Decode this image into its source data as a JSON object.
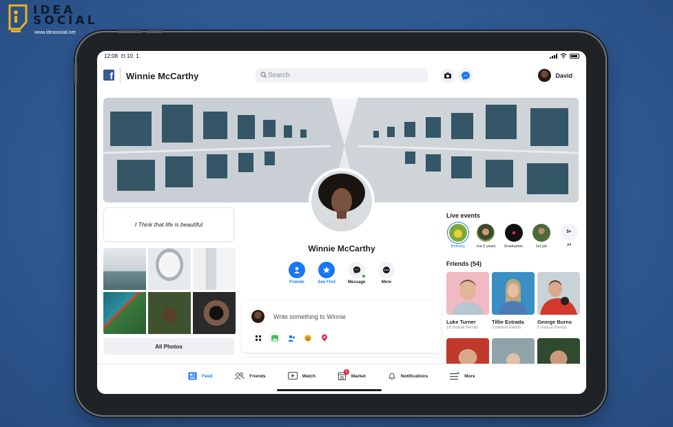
{
  "watermark": {
    "brand": "IDEA SOCIAL",
    "url": "www.ideasocial.net"
  },
  "status_bar": {
    "time": "12:08",
    "date": "čt 10. 1."
  },
  "header": {
    "logo_glyph": "f",
    "page_name": "Winnie McCarthy",
    "search_placeholder": "Search",
    "camera_icon": "camera-icon",
    "messenger_icon": "messenger-icon",
    "user_name": "David"
  },
  "profile": {
    "name": "Winnie McCarthy",
    "intro_quote": "I Think that life is beautiful",
    "actions": [
      {
        "label": "Friends",
        "icon": "friends-icon",
        "color": "#1877f2"
      },
      {
        "label": "See First",
        "icon": "star-icon",
        "color": "#1877f2"
      },
      {
        "label": "Message",
        "icon": "messenger-icon",
        "color": "#f0f2f5"
      },
      {
        "label": "More",
        "icon": "more-icon",
        "color": "#f0f2f5"
      }
    ]
  },
  "photos": {
    "all_photos_label": "All Photos"
  },
  "composer": {
    "prompt": "Write something to Winnie",
    "icons": [
      "apps-icon",
      "photo-icon",
      "tag-friends-icon",
      "feeling-icon",
      "location-icon"
    ]
  },
  "live_events": {
    "title": "Live events",
    "items": [
      {
        "label": "Birthday",
        "selected": true
      },
      {
        "label": "Joe 5 years",
        "selected": false
      },
      {
        "label": "Graduation",
        "selected": false
      },
      {
        "label": "1st job",
        "selected": false
      },
      {
        "label": "All",
        "badge": "5+"
      }
    ]
  },
  "friends": {
    "title": "Friends (54)",
    "items": [
      {
        "name": "Luke Turner",
        "mutual": "18 mutual friends"
      },
      {
        "name": "Tillie Estrada",
        "mutual": "2 mutual friends"
      },
      {
        "name": "George Burns",
        "mutual": "3 mutual friends"
      }
    ]
  },
  "tabbar": {
    "tabs": [
      {
        "label": "Feed",
        "icon": "feed-icon",
        "active": true
      },
      {
        "label": "Friends",
        "icon": "friends-icon"
      },
      {
        "label": "Watch",
        "icon": "watch-icon"
      },
      {
        "label": "Market",
        "icon": "market-icon",
        "badge": "1"
      },
      {
        "label": "Notifications",
        "icon": "bell-icon"
      },
      {
        "label": "More",
        "icon": "menu-icon"
      }
    ]
  },
  "colors": {
    "accent": "#1877f2",
    "brand": "#3b5998",
    "background": "#2f5a93"
  }
}
